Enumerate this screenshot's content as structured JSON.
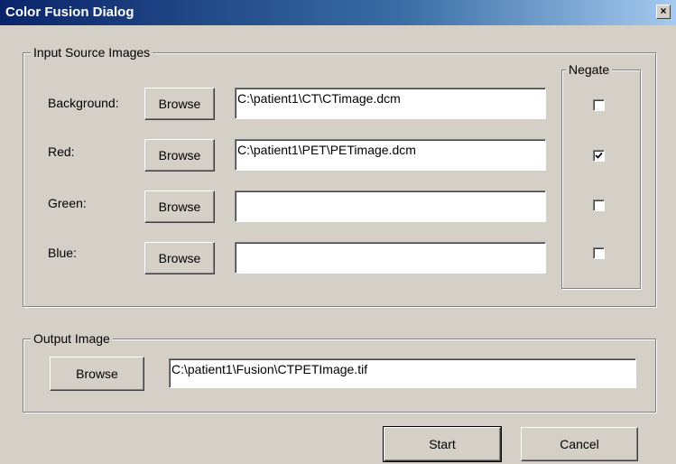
{
  "window": {
    "title": "Color Fusion Dialog",
    "close_glyph": "×"
  },
  "input_group": {
    "legend": "Input Source Images",
    "negate_legend": "Negate",
    "browse_label": "Browse",
    "rows": [
      {
        "label": "Background:",
        "path": "C:\\patient1\\CT\\CTimage.dcm",
        "negate": false
      },
      {
        "label": "Red:",
        "path": "C:\\patient1\\PET\\PETimage.dcm",
        "negate": true
      },
      {
        "label": "Green:",
        "path": "",
        "negate": false
      },
      {
        "label": "Blue:",
        "path": "",
        "negate": false
      }
    ]
  },
  "output_group": {
    "legend": "Output Image",
    "browse_label": "Browse",
    "path": "C:\\patient1\\Fusion\\CTPETImage.tif"
  },
  "actions": {
    "start_label": "Start",
    "cancel_label": "Cancel"
  },
  "colors": {
    "title_gradient_start": "#0a246a",
    "face": "#d4d0c8"
  },
  "icons": {
    "close": "close-icon",
    "check": "checkmark-icon"
  }
}
